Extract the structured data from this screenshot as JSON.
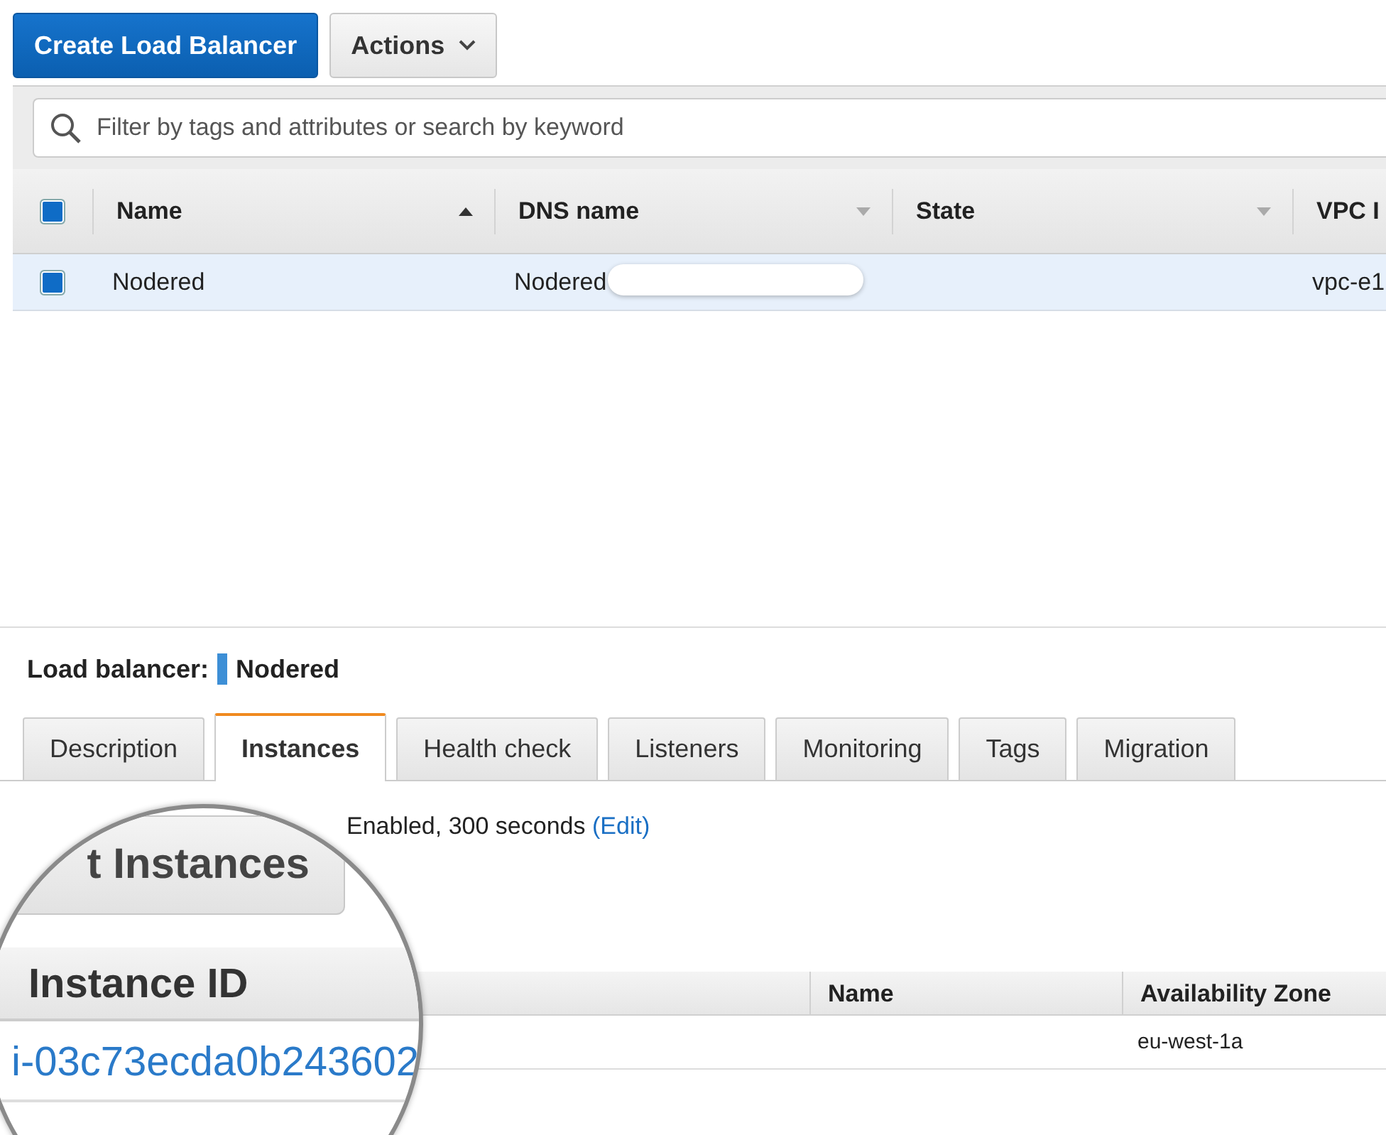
{
  "toolbar": {
    "primary_button": "Create Load Balancer",
    "actions_button": "Actions"
  },
  "search": {
    "placeholder": "Filter by tags and attributes or search by keyword"
  },
  "table": {
    "header_checked": true,
    "columns": [
      {
        "label": "Name",
        "kind": "sorted"
      },
      {
        "label": "DNS name",
        "kind": "menu"
      },
      {
        "label": "State",
        "kind": "menu"
      },
      {
        "label": "VPC I",
        "kind": "plain"
      }
    ],
    "rows": [
      {
        "selected": true,
        "checked": true,
        "cells": [
          {
            "text": "Nodered"
          },
          {
            "text": "Nodered",
            "redacted": true
          },
          {
            "text": ""
          },
          {
            "text": "vpc-e1"
          }
        ]
      }
    ]
  },
  "details": {
    "label": "Load balancer:",
    "name": "Nodered",
    "tabs": [
      {
        "label": "Description",
        "selected": false
      },
      {
        "label": "Instances",
        "selected": true
      },
      {
        "label": "Health check",
        "selected": false
      },
      {
        "label": "Listeners",
        "selected": false
      },
      {
        "label": "Monitoring",
        "selected": false
      },
      {
        "label": "Tags",
        "selected": false
      },
      {
        "label": "Migration",
        "selected": false
      }
    ],
    "draining_text": "Enabled, 300 seconds",
    "edit_link": "(Edit)",
    "instances_columns": [
      "Name",
      "Availability Zone"
    ],
    "instances_rows": [
      {
        "cells": [
          "eu-west-1a"
        ]
      }
    ]
  },
  "magnifier": {
    "button": "t Instances",
    "column": "Instance ID",
    "instance_link": "i-03c73ecda0b243602"
  }
}
